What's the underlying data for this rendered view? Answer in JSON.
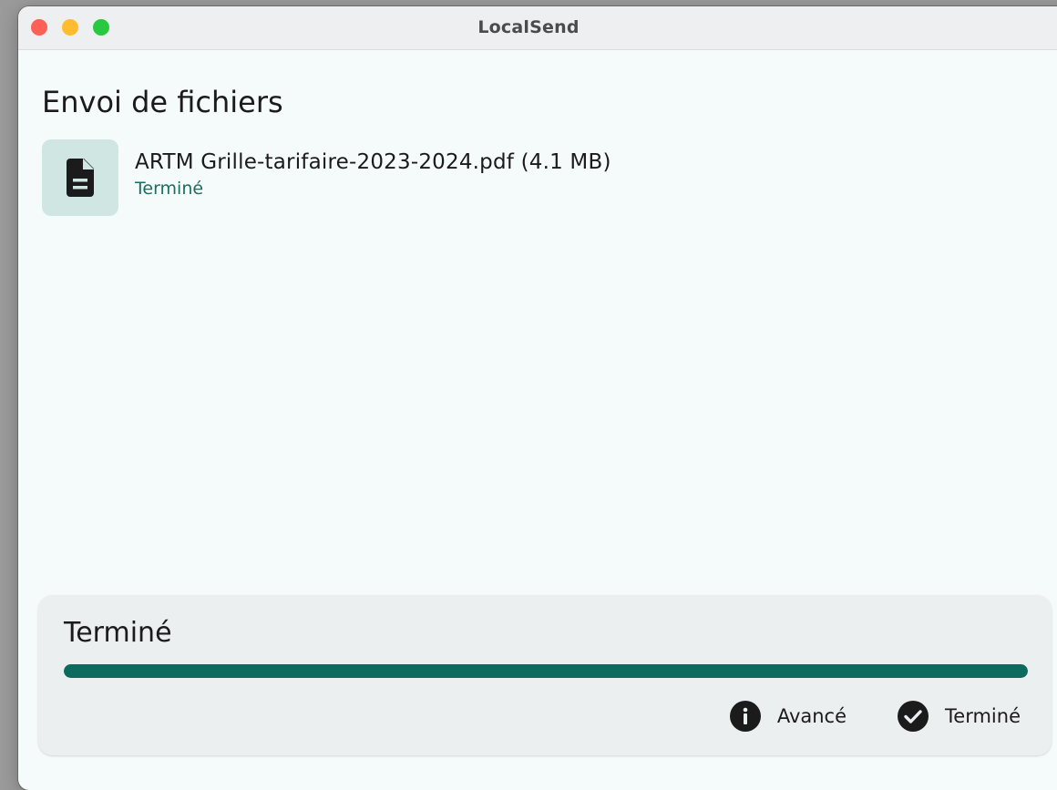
{
  "window": {
    "title": "LocalSend"
  },
  "page": {
    "heading": "Envoi de fichiers"
  },
  "files": [
    {
      "name": "ARTM Grille-tarifaire-2023-2024.pdf (4.1 MB)",
      "status": "Terminé",
      "icon": "document-icon"
    }
  ],
  "progress": {
    "title": "Terminé",
    "fraction": 1.0,
    "advanced_label": "Avancé",
    "done_label": "Terminé"
  },
  "colors": {
    "accent": "#0c6b5c",
    "status_text": "#1d6e62",
    "thumb_bg": "#cfe6e2"
  }
}
